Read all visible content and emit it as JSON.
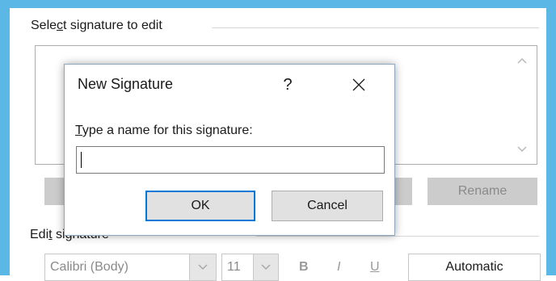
{
  "select_section": {
    "label_prefix": "Sele",
    "label_mnemonic": "c",
    "label_suffix": "t signature to edit"
  },
  "signature_list": {
    "items": []
  },
  "buttons": {
    "rename_label": "Rename"
  },
  "edit_section": {
    "label_prefix": "Edi",
    "label_mnemonic": "t",
    "label_suffix": " signature"
  },
  "toolbar": {
    "font_name": "Calibri (Body)",
    "font_size": "11",
    "bold": "B",
    "italic": "I",
    "underline": "U",
    "color": "Automatic"
  },
  "dialog": {
    "title": "New Signature",
    "help": "?",
    "prompt_mnemonic": "T",
    "prompt_rest": "ype a name for this signature:",
    "name_value": "",
    "ok_label": "OK",
    "cancel_label": "Cancel"
  }
}
